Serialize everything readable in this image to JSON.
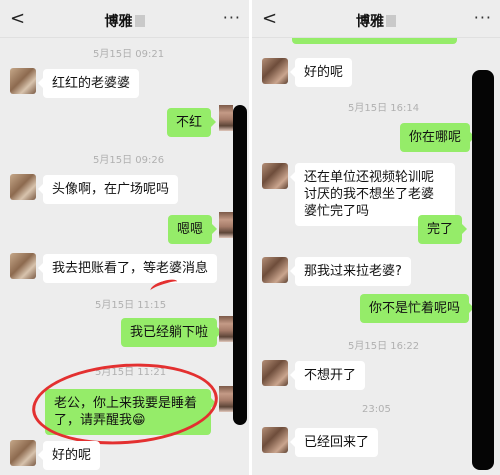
{
  "left": {
    "header": {
      "back": "<",
      "title": "博雅",
      "more": "···"
    },
    "timestamps": [
      "5月15日 09:21",
      "5月15日 09:26",
      "5月15日 11:15",
      "5月15日 11:21"
    ],
    "messages": [
      "红红的老婆婆",
      "不红",
      "头像啊，在广场呢吗",
      "嗯嗯",
      "我去把账看了，等老婆消息",
      "我已经躺下啦",
      "老公，你上来我要是睡着了，请弄醒我😁",
      "好的呢"
    ]
  },
  "right": {
    "header": {
      "back": "<",
      "title": "博雅",
      "more": "···"
    },
    "timestamps": [
      "5月15日 16:14",
      "5月15日 16:22",
      "23:05"
    ],
    "messages": [
      "好的呢",
      "你在哪呢",
      "还在单位还视频轮训呢讨厌的我不想坐了老婆婆忙完了吗",
      "完了",
      "那我过来拉老婆?",
      "你不是忙着呢吗",
      "不想开了",
      "已经回来了"
    ]
  },
  "colors": {
    "incoming": "#ffffff",
    "outgoing": "#95ec69",
    "background": "#ededed",
    "annotation": "#e33030"
  }
}
